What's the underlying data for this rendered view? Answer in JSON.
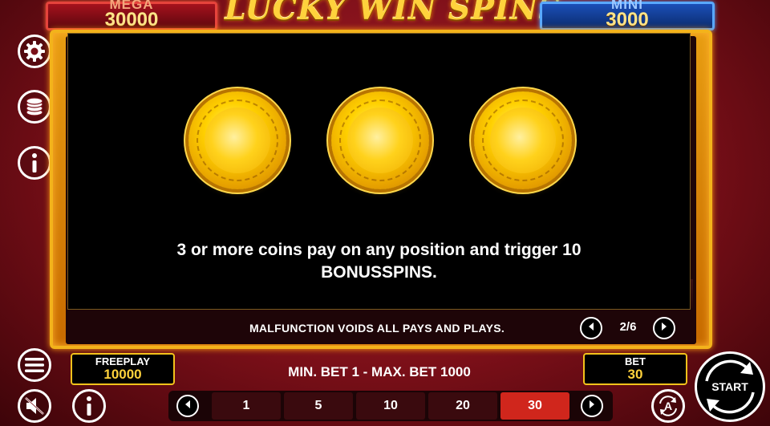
{
  "header": {
    "title": "LUCKY WIN SPINS",
    "jackpot_mega": {
      "label": "MEGA",
      "value": "30000"
    },
    "jackpot_mini": {
      "label": "MINI",
      "value": "3000"
    }
  },
  "sidebar": {
    "icons": [
      "gear-icon",
      "coins-stack-icon",
      "info-icon",
      "menu-icon",
      "sound-off-icon",
      "info-icon"
    ]
  },
  "info_panel": {
    "text_line1": "3 or more coins pay on any position and trigger 10",
    "text_line2": "BONUSSPINS.",
    "coins": 3
  },
  "pager": {
    "disclaimer": "MALFUNCTION VOIDS ALL PAYS AND PLAYS.",
    "page": "2/6"
  },
  "bottom": {
    "freeplay_label": "FREEPLAY",
    "freeplay_value": "10000",
    "bet_range": "MIN. BET 1 - MAX. BET 1000",
    "bet_label": "BET",
    "bet_value": "30",
    "bet_options": [
      "1",
      "5",
      "10",
      "20",
      "30"
    ],
    "selected_bet": "30",
    "start_label": "START",
    "autoplay_label": "A"
  },
  "colors": {
    "accent_gold": "#ffd23c",
    "frame_gold": "#f3b31b",
    "mega_red": "#a5121d",
    "mini_blue": "#1b4fb7",
    "active_chip": "#d0261c"
  }
}
